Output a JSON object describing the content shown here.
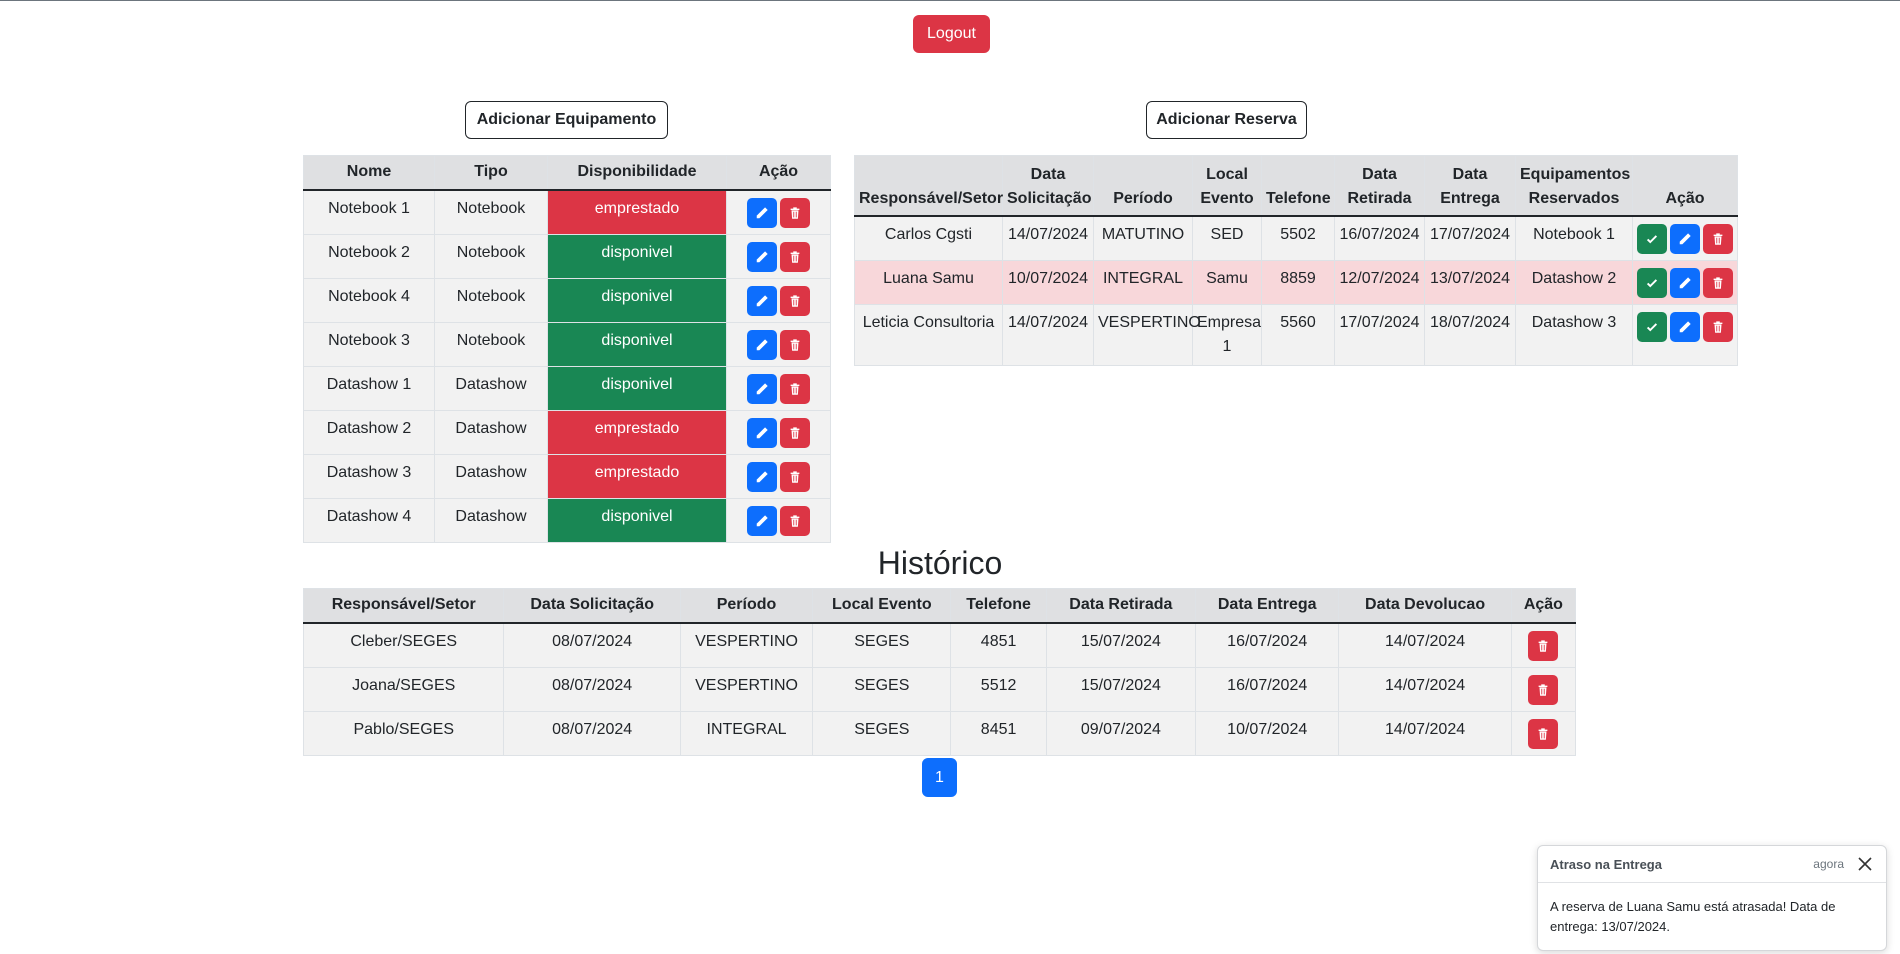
{
  "header": {
    "logout_label": "Logout"
  },
  "equipment": {
    "add_label": "Adicionar Equipamento",
    "columns": [
      "Nome",
      "Tipo",
      "Disponibilidade",
      "Ação"
    ],
    "rows": [
      {
        "nome": "Notebook 1",
        "tipo": "Notebook",
        "disp": "emprestado",
        "status": "red"
      },
      {
        "nome": "Notebook 2",
        "tipo": "Notebook",
        "disp": "disponivel",
        "status": "green"
      },
      {
        "nome": "Notebook 4",
        "tipo": "Notebook",
        "disp": "disponivel",
        "status": "green"
      },
      {
        "nome": "Notebook 3",
        "tipo": "Notebook",
        "disp": "disponivel",
        "status": "green"
      },
      {
        "nome": "Datashow 1",
        "tipo": "Datashow",
        "disp": "disponivel",
        "status": "green"
      },
      {
        "nome": "Datashow 2",
        "tipo": "Datashow",
        "disp": "emprestado",
        "status": "red"
      },
      {
        "nome": "Datashow 3",
        "tipo": "Datashow",
        "disp": "emprestado",
        "status": "red"
      },
      {
        "nome": "Datashow 4",
        "tipo": "Datashow",
        "disp": "disponivel",
        "status": "green"
      }
    ]
  },
  "reservations": {
    "add_label": "Adicionar Reserva",
    "columns": [
      "Responsável/Setor",
      "Data Solicitação",
      "Período",
      "Local Evento",
      "Telefone",
      "Data Retirada",
      "Data Entrega",
      "Equipamentos Reservados",
      "Ação"
    ],
    "rows": [
      {
        "resp": "Carlos Cgsti",
        "sol": "14/07/2024",
        "per": "MATUTINO",
        "local": "SED",
        "tel": "5502",
        "ret": "16/07/2024",
        "ent": "17/07/2024",
        "eq": "Notebook 1",
        "late": false
      },
      {
        "resp": "Luana Samu",
        "sol": "10/07/2024",
        "per": "INTEGRAL",
        "local": "Samu",
        "tel": "8859",
        "ret": "12/07/2024",
        "ent": "13/07/2024",
        "eq": "Datashow 2",
        "late": true
      },
      {
        "resp": "Leticia Consultoria",
        "sol": "14/07/2024",
        "per": "VESPERTINO",
        "local": "Empresa 1",
        "tel": "5560",
        "ret": "17/07/2024",
        "ent": "18/07/2024",
        "eq": "Datashow 3",
        "late": false
      }
    ]
  },
  "history": {
    "title": "Histórico",
    "columns": [
      "Responsável/Setor",
      "Data Solicitação",
      "Período",
      "Local Evento",
      "Telefone",
      "Data Retirada",
      "Data Entrega",
      "Data Devolucao",
      "Ação"
    ],
    "rows": [
      {
        "resp": "Cleber/SEGES",
        "sol": "08/07/2024",
        "per": "VESPERTINO",
        "local": "SEGES",
        "tel": "4851",
        "ret": "15/07/2024",
        "ent": "16/07/2024",
        "dev": "14/07/2024"
      },
      {
        "resp": "Joana/SEGES",
        "sol": "08/07/2024",
        "per": "VESPERTINO",
        "local": "SEGES",
        "tel": "5512",
        "ret": "15/07/2024",
        "ent": "16/07/2024",
        "dev": "14/07/2024"
      },
      {
        "resp": "Pablo/SEGES",
        "sol": "08/07/2024",
        "per": "INTEGRAL",
        "local": "SEGES",
        "tel": "8451",
        "ret": "09/07/2024",
        "ent": "10/07/2024",
        "dev": "14/07/2024"
      }
    ]
  },
  "pagination": {
    "current_page": "1"
  },
  "toast": {
    "title": "Atraso na Entrega",
    "time": "agora",
    "message": "A reserva de Luana Samu está atrasada! Data de entrega: 13/07/2024."
  },
  "colors": {
    "primary": "#0d6efd",
    "danger": "#dc3545",
    "success": "#198754",
    "danger_row": "#f8d7da"
  },
  "icons": {
    "edit": "pencil-icon",
    "delete": "trash-icon",
    "confirm": "check-icon",
    "close": "close-icon"
  }
}
